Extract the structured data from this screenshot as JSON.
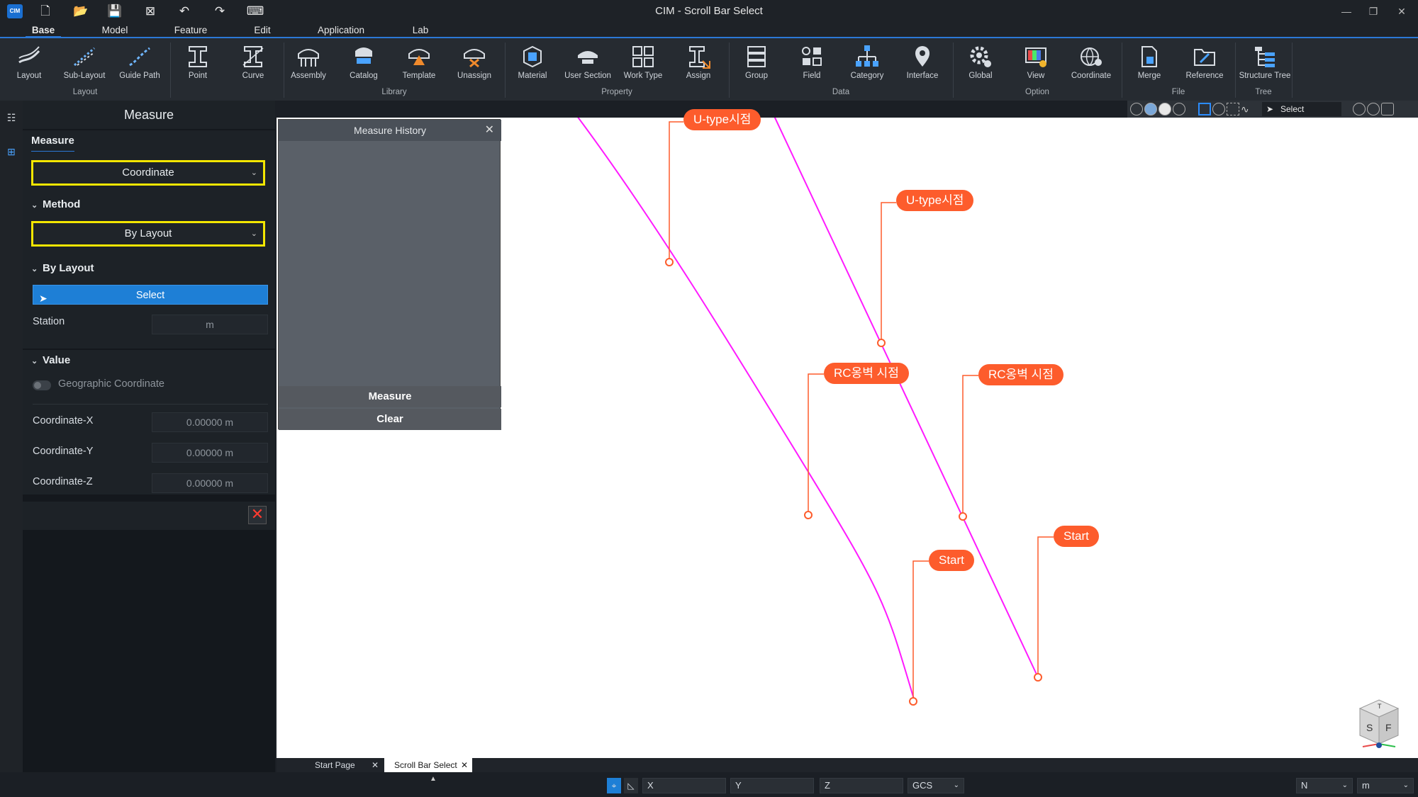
{
  "window": {
    "logo_text": "CIM",
    "title": "CIM - Scroll Bar Select"
  },
  "menu_tabs": [
    "Base",
    "Model",
    "Feature",
    "Edit",
    "Application",
    "Lab"
  ],
  "ribbon": {
    "buttons": [
      "Layout",
      "Sub-Layout",
      "Guide Path",
      "Point",
      "Curve",
      "Assembly",
      "Catalog",
      "Template",
      "Unassign",
      "Material",
      "User Section",
      "Work Type",
      "Assign",
      "Group",
      "Field",
      "Category",
      "Interface",
      "Global",
      "View",
      "Coordinate",
      "Merge",
      "Reference",
      "Structure Tree"
    ],
    "groups": [
      "Layout",
      "Library",
      "Property",
      "Data",
      "Option",
      "File",
      "Tree"
    ]
  },
  "viewport_toolbar": {
    "mode_label": "Select"
  },
  "panel": {
    "title": "Measure",
    "measure_section": "Measure",
    "measure_value": "Coordinate",
    "method_section": "Method",
    "method_value": "By Layout",
    "by_layout_section": "By Layout",
    "select_label": "Select",
    "station_label": "Station",
    "station_unit": "m",
    "value_section": "Value",
    "geo_label": "Geographic Coordinate",
    "geo_enabled": false,
    "coord_x_label": "Coordinate-X",
    "coord_x_value": "0.00000 m",
    "coord_y_label": "Coordinate-Y",
    "coord_y_value": "0.00000 m",
    "coord_z_label": "Coordinate-Z",
    "coord_z_value": "0.00000 m"
  },
  "history": {
    "title": "Measure History",
    "measure_label": "Measure",
    "clear_label": "Clear"
  },
  "callouts": [
    "U-type시점",
    "U-type시점",
    "RC옹벽 시점",
    "RC옹벽 시점",
    "Start",
    "Start"
  ],
  "doc_tabs": [
    "Start Page",
    "Scroll Bar Select"
  ],
  "status": {
    "x_label": "X",
    "y_label": "Y",
    "z_label": "Z",
    "cs": "GCS",
    "direction": "N",
    "unit": "m"
  },
  "colors": {
    "accent": "#1e7fd6",
    "highlight": "#f3e600",
    "layout_line": "#ff1aff",
    "callout": "#fd5c2c"
  },
  "viewcube": {
    "s": "S",
    "f": "F",
    "t": "T"
  }
}
